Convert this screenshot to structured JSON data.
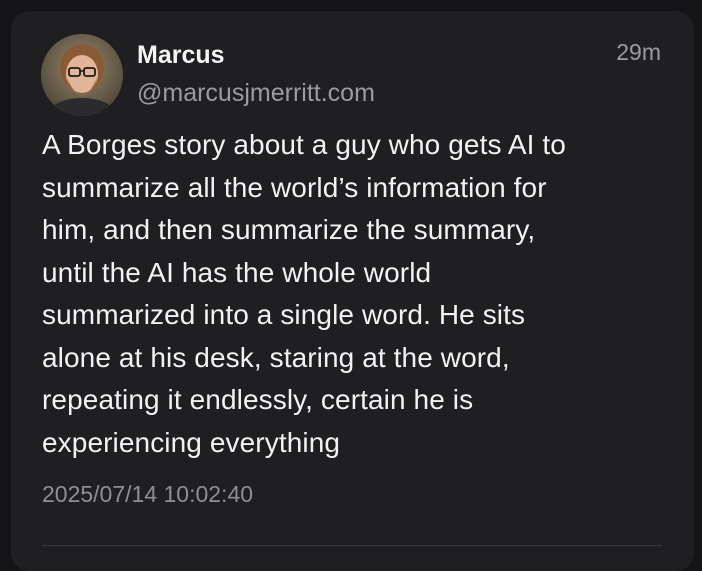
{
  "post": {
    "author_name": "Marcus",
    "author_handle": "@marcusjmerritt.com",
    "relative_time": "29m",
    "text": "A Borges story about a guy who gets AI to\nsummarize all the world’s information for\nhim, and then summarize the summary,\nuntil the AI has the whole world\nsummarized into a single word. He sits\nalone at his desk, staring at the word,\nrepeating it endlessly, certain he is\nexperiencing everything",
    "timestamp": "2025/07/14 10:02:40"
  },
  "colors": {
    "background": "#141416",
    "card": "#1f1f22",
    "primary_text": "#f2f2f2",
    "secondary_text": "#9b9ba1"
  }
}
